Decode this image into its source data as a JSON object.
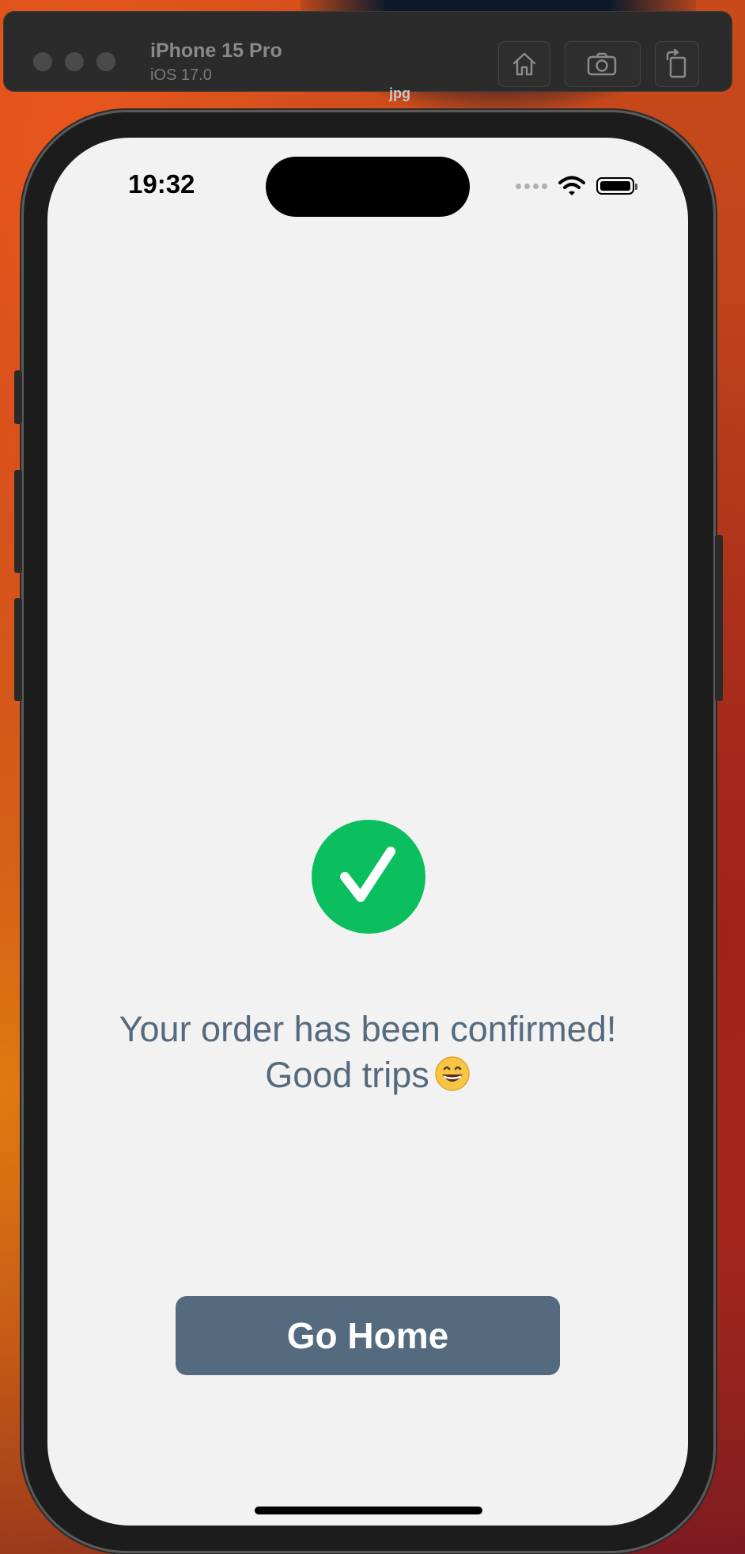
{
  "simulator": {
    "device_name": "iPhone 15 Pro",
    "os_version": "iOS 17.0",
    "file_label": "jpg",
    "toolbar_icons": [
      "home-icon",
      "screenshot-icon",
      "rotate-icon"
    ]
  },
  "status_bar": {
    "time": "19:32",
    "icons": [
      "cellular-signal-icon",
      "wifi-icon",
      "battery-icon"
    ]
  },
  "confirmation": {
    "icon": "check-circle-icon",
    "icon_color": "#0bbf5e",
    "message_line1": "Your order has been confirmed!",
    "message_line2": "Good trips",
    "emoji": "grinning-face-icon",
    "text_color": "#566a7e"
  },
  "actions": {
    "go_home_label": "Go Home",
    "button_color": "#546a7e"
  }
}
